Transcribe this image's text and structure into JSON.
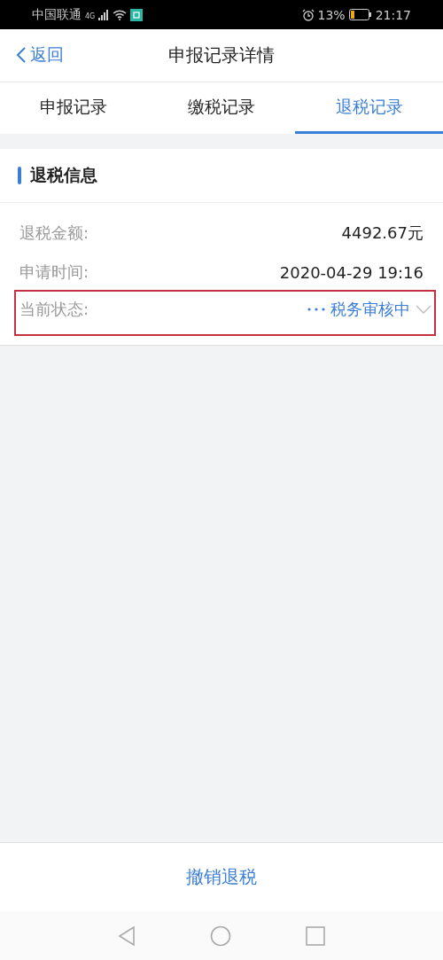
{
  "status_bar": {
    "carrier": "中国联通",
    "network": "4G",
    "battery": "13%",
    "time": "21:17"
  },
  "nav": {
    "back": "返回",
    "title": "申报记录详情"
  },
  "tabs": [
    {
      "label": "申报记录",
      "selected": false
    },
    {
      "label": "缴税记录",
      "selected": false
    },
    {
      "label": "退税记录",
      "selected": true
    }
  ],
  "section": {
    "title": "退税信息"
  },
  "fields": [
    {
      "kind": "text",
      "label": "退税金额:",
      "value": "4492.67元",
      "highlighted": false
    },
    {
      "kind": "text",
      "label": "申请时间:",
      "value": "2020-04-29 19:16",
      "highlighted": false
    },
    {
      "kind": "status",
      "label": "当前状态:",
      "value": "税务审核中",
      "highlighted": true
    }
  ],
  "action": {
    "label": "撤销退税"
  }
}
